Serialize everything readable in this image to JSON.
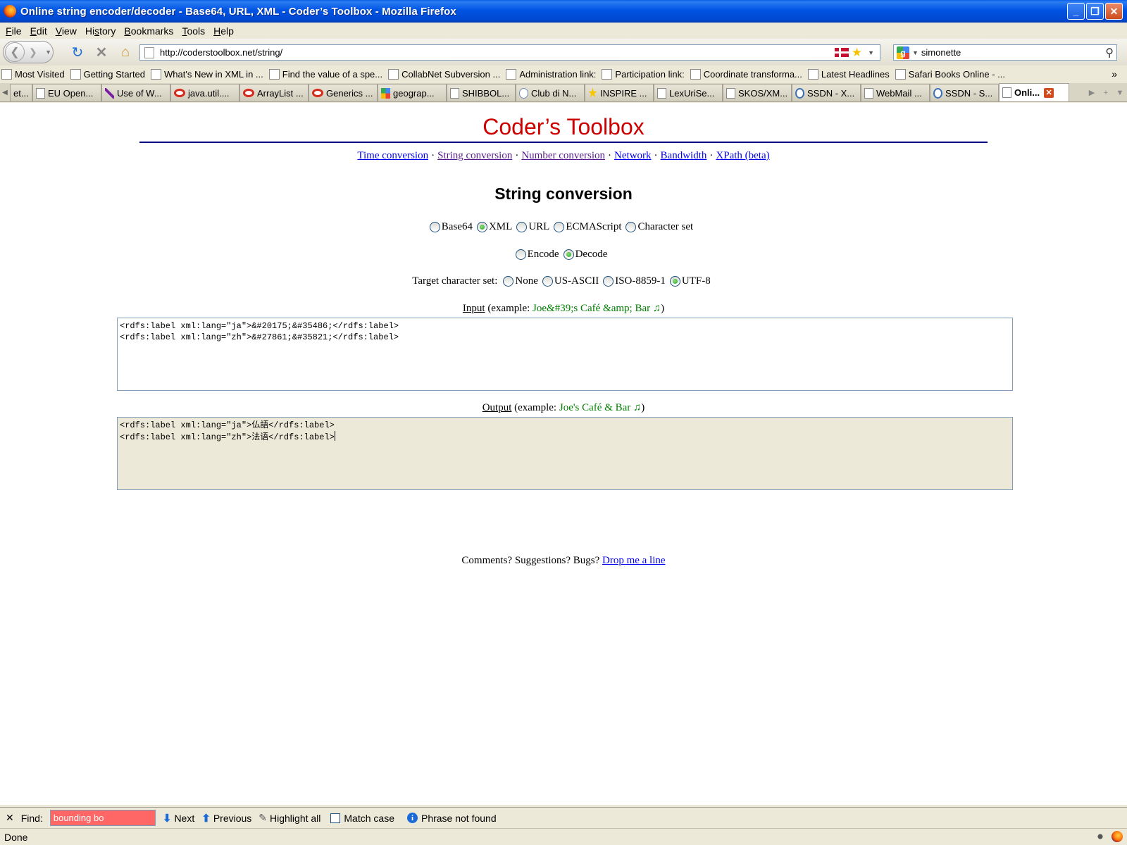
{
  "window": {
    "title": "Online string encoder/decoder - Base64, URL, XML - Coder’s Toolbox - Mozilla Firefox"
  },
  "menubar": [
    {
      "label": "File",
      "accel": "F"
    },
    {
      "label": "Edit",
      "accel": "E"
    },
    {
      "label": "View",
      "accel": "V"
    },
    {
      "label": "History",
      "accel": "s"
    },
    {
      "label": "Bookmarks",
      "accel": "B"
    },
    {
      "label": "Tools",
      "accel": "T"
    },
    {
      "label": "Help",
      "accel": "H"
    }
  ],
  "navbar": {
    "url": "http://coderstoolbox.net/string/",
    "search_value": "simonette"
  },
  "bookmarks": [
    "Most Visited",
    "Getting Started",
    "What's New in XML in ...",
    "Find the value of a spe...",
    "CollabNet Subversion ...",
    "Administration link:",
    "Participation link:",
    "Coordinate transforma...",
    "Latest Headlines",
    "Safari Books Online - ..."
  ],
  "tabs": [
    {
      "label": "et...",
      "icon": "page"
    },
    {
      "label": "EU Open...",
      "icon": "page"
    },
    {
      "label": "Use of W...",
      "icon": "feather"
    },
    {
      "label": "java.util....",
      "icon": "red"
    },
    {
      "label": "ArrayList ...",
      "icon": "red"
    },
    {
      "label": "Generics ...",
      "icon": "red"
    },
    {
      "label": "geograp...",
      "icon": "gmap"
    },
    {
      "label": "SHIBBOL...",
      "icon": "page"
    },
    {
      "label": "Club di N...",
      "icon": "club"
    },
    {
      "label": "INSPIRE ...",
      "icon": "inspire"
    },
    {
      "label": "LexUriSe...",
      "icon": "page"
    },
    {
      "label": "SKOS/XM...",
      "icon": "page"
    },
    {
      "label": "SSDN - X...",
      "icon": "sap"
    },
    {
      "label": "WebMail ...",
      "icon": "page"
    },
    {
      "label": "SSDN - S...",
      "icon": "sap"
    },
    {
      "label": "Onli...",
      "icon": "page",
      "active": true
    }
  ],
  "page": {
    "site_title": "Coder’s Toolbox",
    "nav_links": [
      {
        "label": "Time conversion",
        "visited": false
      },
      {
        "label": "String conversion",
        "visited": true
      },
      {
        "label": "Number conversion",
        "visited": true
      },
      {
        "label": "Network",
        "visited": false
      },
      {
        "label": "Bandwidth",
        "visited": false
      },
      {
        "label": "XPath (beta)",
        "visited": false
      }
    ],
    "nav_separator": "·",
    "section_title": "String conversion",
    "formats": [
      {
        "label": "Base64",
        "checked": false
      },
      {
        "label": "XML",
        "checked": true
      },
      {
        "label": "URL",
        "checked": false
      },
      {
        "label": "ECMAScript",
        "checked": false
      },
      {
        "label": "Character set",
        "checked": false
      }
    ],
    "modes": [
      {
        "label": "Encode",
        "checked": false
      },
      {
        "label": "Decode",
        "checked": true
      }
    ],
    "charset_label": "Target character set:",
    "charsets": [
      {
        "label": "None",
        "checked": false
      },
      {
        "label": "US-ASCII",
        "checked": false
      },
      {
        "label": "ISO-8859-1",
        "checked": false
      },
      {
        "label": "UTF-8",
        "checked": true
      }
    ],
    "input": {
      "label": "Input",
      "example_prefix": "(example: ",
      "example": "Joe&#39;s Café &amp; Bar ♫",
      "example_suffix": ")",
      "value": "<rdfs:label xml:lang=\"ja\">&#20175;&#35486;</rdfs:label>\n<rdfs:label xml:lang=\"zh\">&#27861;&#35821;</rdfs:label>"
    },
    "output": {
      "label": "Output",
      "example_prefix": "(example: ",
      "example": "Joe's Café & Bar ♫",
      "example_suffix": ")",
      "value": "<rdfs:label xml:lang=\"ja\">仏語</rdfs:label>\n<rdfs:label xml:lang=\"zh\">法语</rdfs:label>"
    },
    "footer_text": "Comments? Suggestions? Bugs?",
    "footer_link": "Drop me a line"
  },
  "findbar": {
    "label": "Find:",
    "value": "bounding bo",
    "next": "Next",
    "previous": "Previous",
    "highlight_all": "Highlight all",
    "match_case": "Match case",
    "status": "Phrase not found"
  },
  "statusbar": {
    "text": "Done"
  }
}
